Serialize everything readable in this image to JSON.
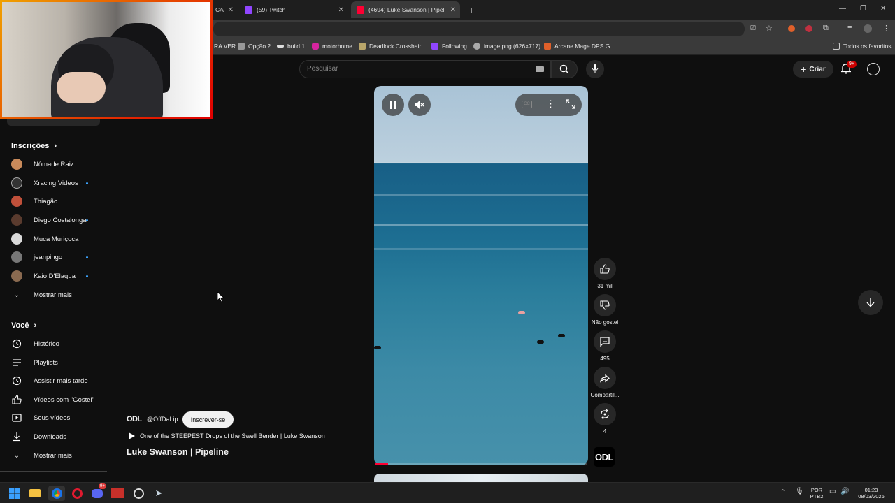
{
  "browser": {
    "tabs": [
      {
        "label": "(59) Twitch",
        "color": "#9146ff"
      },
      {
        "label": "(4694) Luke Swanson | Pipeline",
        "color": "#ff0033",
        "active": true
      }
    ],
    "partial_tab": "CA",
    "bookmarks": [
      "RA VER",
      "Opção 2",
      "build 1",
      "motorhome",
      "Deadlock Crosshair...",
      "Following",
      "image.png (626×717)",
      "Arcane Mage DPS G..."
    ],
    "all_bookmarks": "Todos os favoritos"
  },
  "masthead": {
    "search_placeholder": "Pesquisar",
    "create_label": "Criar",
    "notifications_badge": "9+"
  },
  "sidebar": {
    "subscriptions_title": "Inscrições",
    "subscriptions": [
      {
        "name": "Nômade Raiz",
        "color": "#c98a5a",
        "new": false
      },
      {
        "name": "Xracing Videos",
        "color": "#333333",
        "new": true
      },
      {
        "name": "Thiagão",
        "color": "#c0503a",
        "new": false
      },
      {
        "name": "Diego Costalonga",
        "color": "#5a3b2e",
        "new": true
      },
      {
        "name": "Muca Muriçoca",
        "color": "#d9d9d9",
        "new": false
      },
      {
        "name": "jeanpingo",
        "color": "#777777",
        "new": true
      },
      {
        "name": "Kaio D'Elaqua",
        "color": "#8a6a50",
        "new": true
      }
    ],
    "show_more_1": "Mostrar mais",
    "you_title": "Você",
    "you_items": [
      {
        "label": "Histórico",
        "icon": "history-icon"
      },
      {
        "label": "Playlists",
        "icon": "playlists-icon"
      },
      {
        "label": "Assistir mais tarde",
        "icon": "watch-later-icon"
      },
      {
        "label": "Vídeos com \"Gostei\"",
        "icon": "liked-icon"
      },
      {
        "label": "Seus vídeos",
        "icon": "your-videos-icon"
      },
      {
        "label": "Downloads",
        "icon": "download-icon"
      }
    ],
    "show_more_2": "Mostrar mais"
  },
  "short": {
    "channel_logo": "ODL",
    "channel_handle": "@OffDaLip",
    "subscribe_label": "Inscrever-se",
    "description": "One of the STEEPEST Drops of the Swell Bender | Luke Swanson",
    "title": "Luke Swanson | Pipeline",
    "progress": 0.06,
    "actions": {
      "likes": "31 mil",
      "dislike_label": "Não gostei",
      "comments": "495",
      "share_label": "Compartil...",
      "remix_count": "4"
    }
  },
  "taskbar": {
    "lang_1": "POR",
    "lang_2": "PTB2",
    "time": "01:23",
    "date": "08/03/2026",
    "discord_badge": "9+"
  }
}
